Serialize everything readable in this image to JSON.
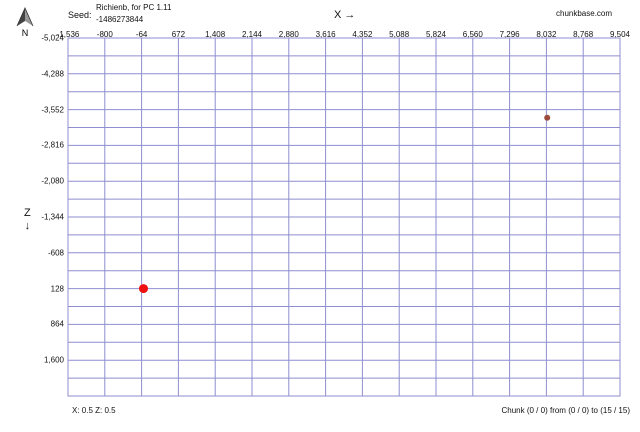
{
  "header": {
    "seed_label": "Seed:",
    "seed_line1": "Richienb, for PC 1.11",
    "seed_line2": "-1486273844",
    "x_axis_title": "X →",
    "site": "chunkbase.com"
  },
  "compass": {
    "letter": "N"
  },
  "z_axis": {
    "title": "Z\n↓"
  },
  "grid": {
    "x_ticks": [
      "-1,536",
      "-800",
      "-64",
      "672",
      "1,408",
      "2,144",
      "2,880",
      "3,616",
      "4,352",
      "5,088",
      "5,824",
      "6,560",
      "7,296",
      "8,032",
      "8,768",
      "9,504"
    ],
    "z_ticks": [
      "-5,024",
      "-4,288",
      "-3,552",
      "-2,816",
      "-2,080",
      "-1,344",
      "-608",
      "128",
      "864",
      "1,600"
    ],
    "x_min": -1536,
    "x_max": 9504,
    "z_min": -5024,
    "z_max": 2336,
    "line_color": "#8e8ed0",
    "bg_color": "#ffffff"
  },
  "markers": [
    {
      "name": "spawn-marker",
      "x": -26,
      "z": 128,
      "color": "#ee1111",
      "size": "large"
    },
    {
      "name": "structure-marker",
      "x": 8048,
      "z": -3385,
      "color": "#9b4a3c",
      "size": "small"
    }
  ],
  "footer": {
    "coords": "X: 0.5   Z: 0.5",
    "chunk": "Chunk (0 / 0) from (0 / 0) to (15 / 15)"
  }
}
